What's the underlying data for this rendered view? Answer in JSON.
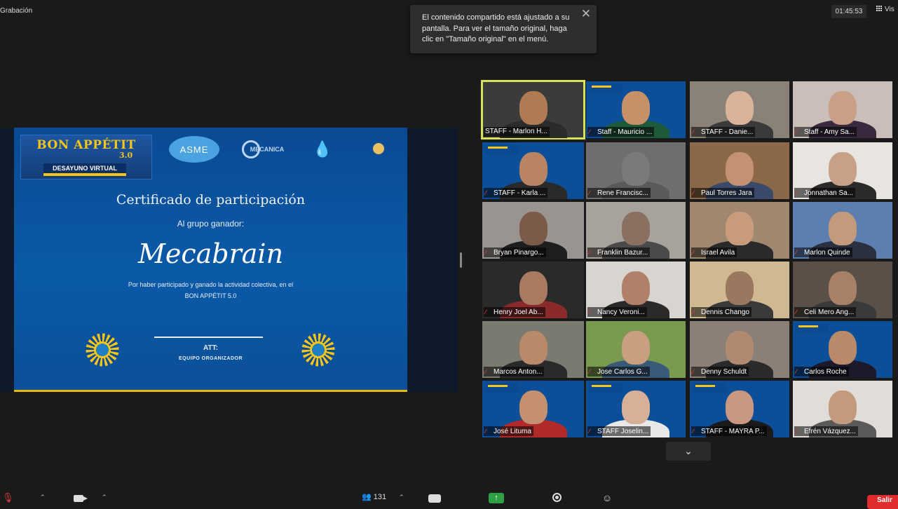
{
  "recording": {
    "label": "Grabación"
  },
  "notification": {
    "text": "El contenido compartido está ajustado a su pantalla. Para ver el tamaño original, haga clic en \"Tamaño original\" en el menú.",
    "close_glyph": "✕"
  },
  "meeting": {
    "elapsed": "01:45:53",
    "view_label": "Vis"
  },
  "certificate": {
    "event_title": "BON APPÉTIT",
    "event_version": "3.0",
    "event_subtitle": "DESAYUNO VIRTUAL",
    "logos": [
      "ASME",
      "MECANICA"
    ],
    "title": "Certificado de participación",
    "group_label": "Al grupo ganador:",
    "winner": "Mecabrain",
    "reason": "Por haber participado y ganado la actividad colectiva, en el BON APPÉTIT 5.0",
    "signature_att": "ATT:",
    "signature_org": "EQUIPO ORGANIZADOR"
  },
  "participants": [
    {
      "name": "STAFF - Marlon H...",
      "muted": false,
      "active": true,
      "bg": "#3b3b3b",
      "skin": "#b07a55",
      "shirt": "#2b2b2b"
    },
    {
      "name": "Staff - Mauricio ...",
      "muted": true,
      "active": false,
      "bg": "#0b4f98",
      "skin": "#c69068",
      "shirt": "#1d5a3a",
      "banner": true
    },
    {
      "name": "STAFF - Danie...",
      "muted": true,
      "active": false,
      "bg": "#8a8177",
      "skin": "#d9b49a",
      "shirt": "#3a3a3a"
    },
    {
      "name": "Staff - Amy Sa...",
      "muted": true,
      "active": false,
      "bg": "#c9bfb8",
      "skin": "#c99f86",
      "shirt": "#3a2a40"
    },
    {
      "name": "STAFF - Karla ...",
      "muted": true,
      "active": false,
      "bg": "#0b4f98",
      "skin": "#b98463",
      "shirt": "#2a2a2a",
      "banner": true
    },
    {
      "name": "Rene Francisc...",
      "muted": true,
      "active": false,
      "bg": "#6e6e6e",
      "skin": "#7a7a7a",
      "shirt": "#5a5a5a"
    },
    {
      "name": "Paul Torres Jara",
      "muted": true,
      "active": false,
      "bg": "#8a6848",
      "skin": "#c39273",
      "shirt": "#3b4a6a"
    },
    {
      "name": "Jonnathan Sa...",
      "muted": true,
      "active": false,
      "bg": "#e8e4e0",
      "skin": "#c8a088",
      "shirt": "#2b2b2b"
    },
    {
      "name": "Bryan Pinargo...",
      "muted": true,
      "active": false,
      "bg": "#9a9490",
      "skin": "#7a5a48",
      "shirt": "#1e1e1e"
    },
    {
      "name": "Franklin Bazur...",
      "muted": true,
      "active": false,
      "bg": "#a8a29c",
      "skin": "#8a7060",
      "shirt": "#4a4a4a"
    },
    {
      "name": "Israel Avila",
      "muted": true,
      "active": false,
      "bg": "#a08870",
      "skin": "#c89c7a",
      "shirt": "#2a2a2a"
    },
    {
      "name": "Marlon Quinde",
      "muted": true,
      "active": false,
      "bg": "#5d7fb0",
      "skin": "#c49a7c",
      "shirt": "#2a3040"
    },
    {
      "name": "Henry Joel Ab...",
      "muted": true,
      "active": false,
      "bg": "#2a2a2a",
      "skin": "#a87a60",
      "shirt": "#8a2a2a"
    },
    {
      "name": "Nancy Veroni...",
      "muted": true,
      "active": false,
      "bg": "#d8d4d0",
      "skin": "#b08068",
      "shirt": "#2a2a2a"
    },
    {
      "name": "Dennis Chango",
      "muted": true,
      "active": false,
      "bg": "#d0b890",
      "skin": "#9a7860",
      "shirt": "#3a3a3a"
    },
    {
      "name": "Celi Mero Ang...",
      "muted": true,
      "active": false,
      "bg": "#5a5048",
      "skin": "#a88068",
      "shirt": "#3a3a3a"
    },
    {
      "name": "Marcos Anton...",
      "muted": true,
      "active": false,
      "bg": "#7a7a70",
      "skin": "#b88a6a",
      "shirt": "#2a2a2a"
    },
    {
      "name": "Jose Carlos G...",
      "muted": true,
      "active": false,
      "bg": "#7a9a50",
      "skin": "#c8a080",
      "shirt": "#3a5a7a"
    },
    {
      "name": "Denny Schuldt",
      "muted": true,
      "active": false,
      "bg": "#8a8078",
      "skin": "#b08a70",
      "shirt": "#2a2a2a"
    },
    {
      "name": "Carlos Roche",
      "muted": true,
      "active": false,
      "bg": "#0b4f98",
      "skin": "#b88a6a",
      "shirt": "#1a1a2a",
      "banner": true
    },
    {
      "name": "José Lituma",
      "muted": true,
      "active": false,
      "bg": "#0b4f98",
      "skin": "#c49070",
      "shirt": "#b02a2a",
      "banner": true
    },
    {
      "name": "STAFF Joselin...",
      "muted": true,
      "active": false,
      "bg": "#0b4f98",
      "skin": "#d8b098",
      "shirt": "#e8e8e8",
      "banner": true
    },
    {
      "name": "STAFF - MAYRA P...",
      "muted": true,
      "active": false,
      "bg": "#0b4f98",
      "skin": "#c89880",
      "shirt": "#1a1a1a",
      "banner": true
    },
    {
      "name": "Efrén Vázquez...",
      "muted": true,
      "active": false,
      "bg": "#e0dcd8",
      "skin": "#c49a7c",
      "shirt": "#5a5a5a"
    }
  ],
  "toolbar": {
    "participants_count": "131",
    "leave_label": "Salir"
  },
  "colors": {
    "accent_active": "#d6e25a",
    "mute_red": "#e03a3a",
    "share_green": "#2ea043",
    "leave_red": "#e02c2c"
  },
  "icons": [
    "microphone-muted-icon",
    "video-camera-icon",
    "participants-icon",
    "chat-icon",
    "share-screen-icon",
    "record-icon",
    "reactions-icon",
    "gallery-grid-icon",
    "close-icon",
    "chevron-down-icon"
  ]
}
